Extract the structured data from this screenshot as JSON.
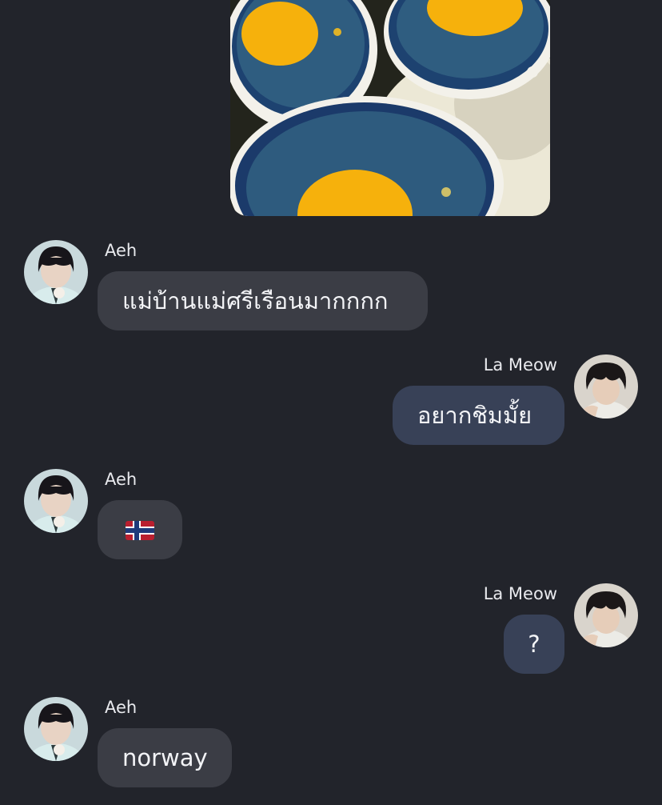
{
  "photo": {
    "alt_semantic": "blue-custard-cups-with-yolk"
  },
  "messages": [
    {
      "sender": "Aeh",
      "direction": "incoming",
      "text": "แม่บ้านแม่ศรีเรือนมากกกก"
    },
    {
      "sender": "La Meow",
      "direction": "outgoing",
      "text": "อยากชิมมั้ย"
    },
    {
      "sender": "Aeh",
      "direction": "incoming",
      "emoji": "norway-flag-emoji"
    },
    {
      "sender": "La Meow",
      "direction": "outgoing",
      "text": "?"
    },
    {
      "sender": "Aeh",
      "direction": "incoming",
      "text": "norway"
    }
  ],
  "colors": {
    "background": "#22242b",
    "incoming_bubble": "#3b3d45",
    "outgoing_bubble": "#384157",
    "text": "#f3f4f7"
  }
}
